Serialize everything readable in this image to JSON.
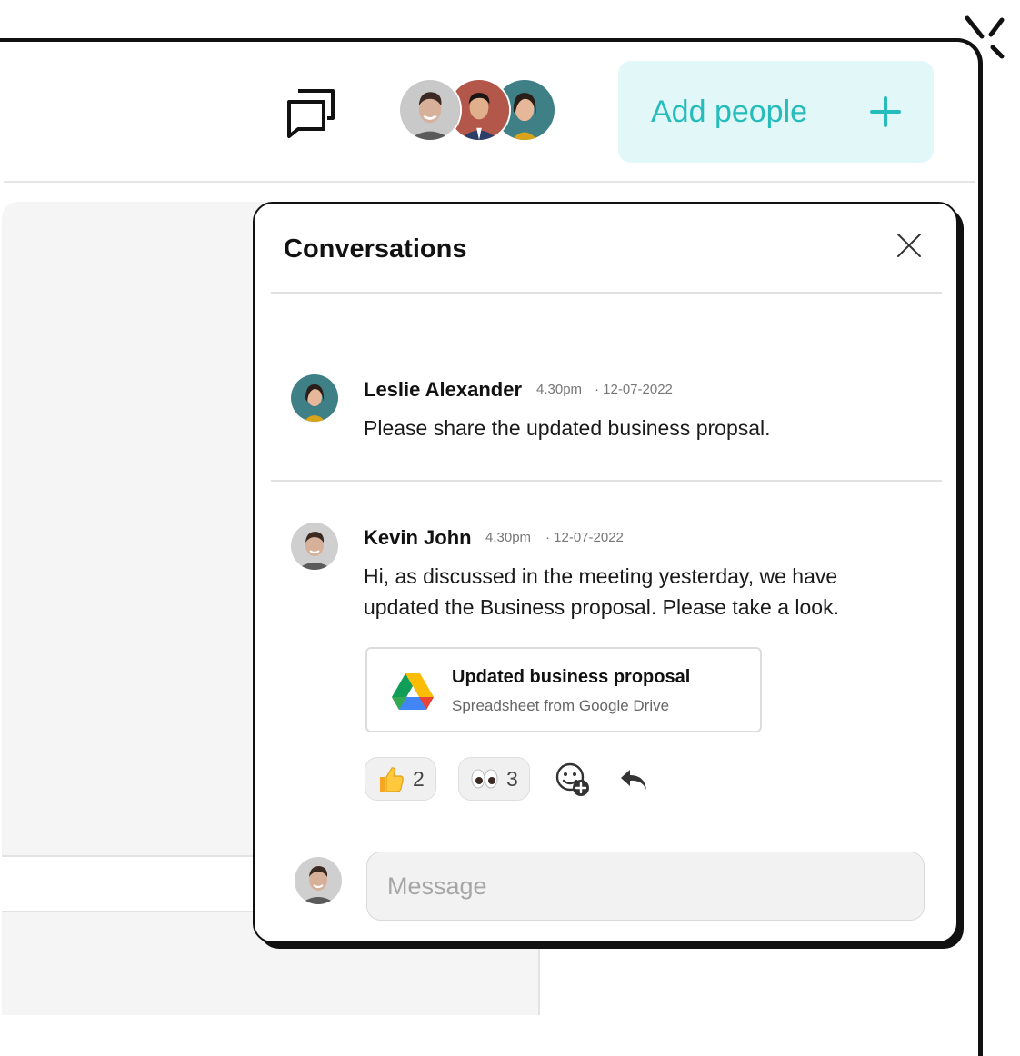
{
  "header": {
    "add_people_label": "Add people"
  },
  "conversations": {
    "title": "Conversations",
    "messages": [
      {
        "author": "Leslie Alexander",
        "time": "4.30pm",
        "date": "· 12-07-2022",
        "text": "Please share the updated business propsal."
      },
      {
        "author": "Kevin John",
        "time": "4.30pm",
        "date": "· 12-07-2022",
        "text": "Hi, as discussed in the meeting yesterday, we have updated the Business proposal. Please take a look.",
        "attachment": {
          "title": "Updated business proposal",
          "subtitle": "Spreadsheet from Google Drive"
        },
        "reactions": [
          {
            "emoji": "thumbs-up",
            "count": "2"
          },
          {
            "emoji": "eyes",
            "count": "3"
          }
        ]
      }
    ],
    "composer": {
      "placeholder": "Message"
    }
  },
  "colors": {
    "accent": "#26bcbc",
    "accent_bg": "#e2f7f7",
    "frame": "#111111"
  }
}
